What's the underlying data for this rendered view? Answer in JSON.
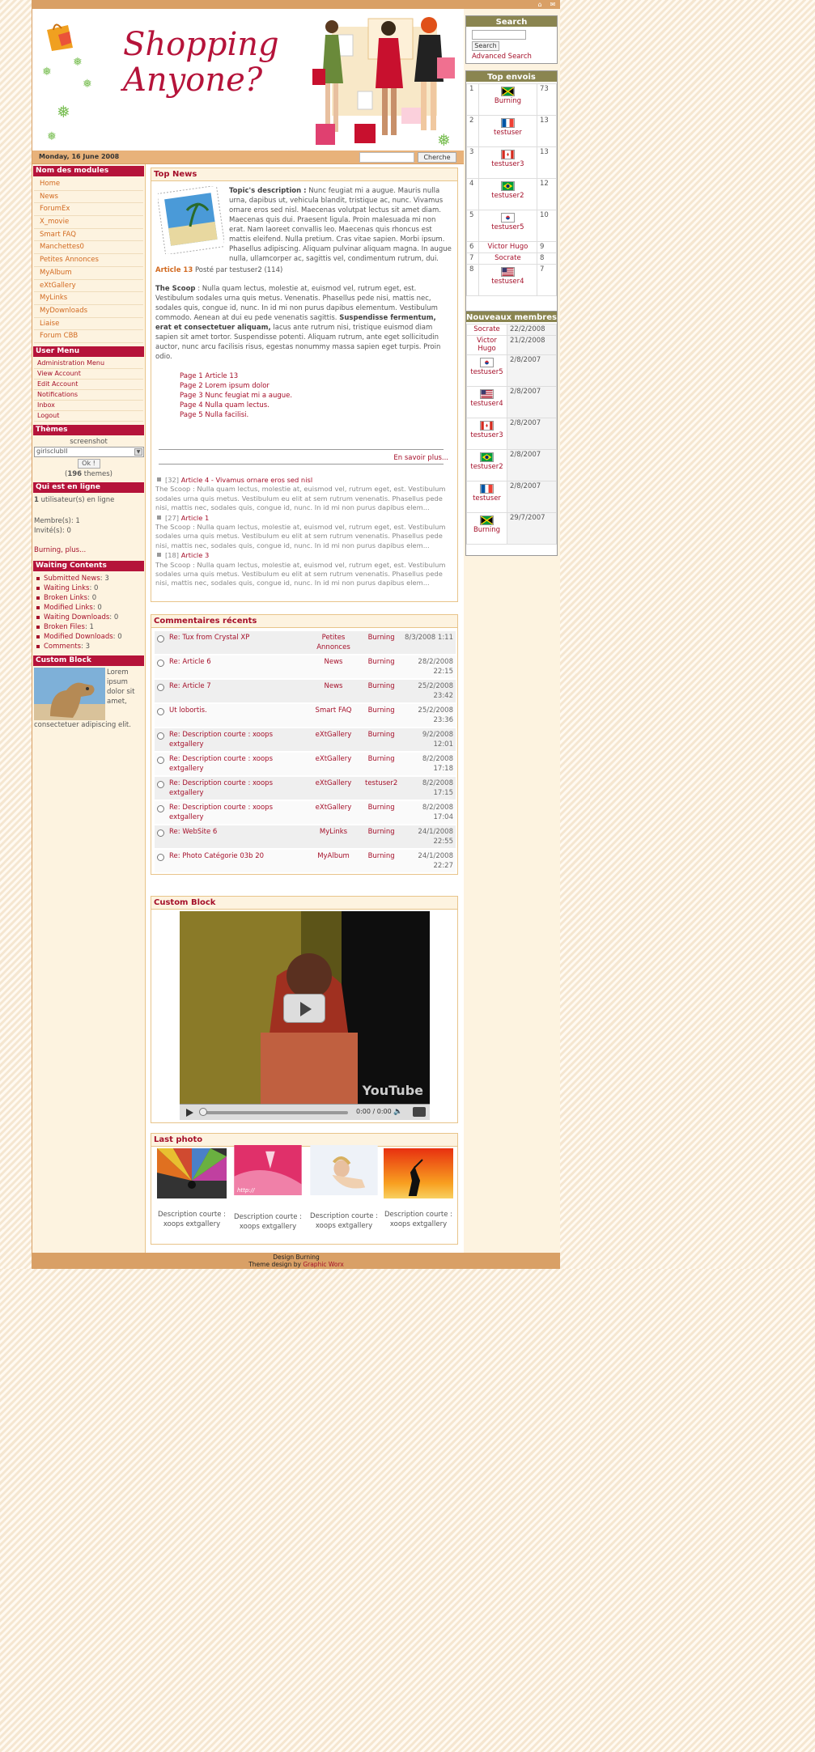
{
  "topbar": {
    "icons": [
      "home-icon",
      "mail-icon"
    ]
  },
  "header": {
    "logo_line1": "Shopping",
    "logo_line2": "Anyone?"
  },
  "datebar": {
    "date": "Monday, 16 June 2008",
    "search_button": "Cherche",
    "search_value": ""
  },
  "left": {
    "modules_title": "Nom des modules",
    "modules": [
      "Home",
      "News",
      "ForumEx",
      "X_movie",
      "Smart FAQ",
      "Manchettes0",
      "Petites Annonces",
      "MyAlbum",
      "eXtGallery",
      "MyLinks",
      "MyDownloads",
      "Liaise",
      "Forum CBB"
    ],
    "user_menu_title": "User Menu",
    "user_menu": [
      "Administration Menu",
      "View Account",
      "Edit Account",
      "Notifications",
      "Inbox",
      "Logout"
    ],
    "themes_title": "Thèmes",
    "themes_label": "screenshot",
    "themes_select": "girlsclubII",
    "themes_ok": "Ok !",
    "themes_count": "196",
    "themes_suffix": "themes)",
    "themes_prefix": "(",
    "online_title": "Qui est en ligne",
    "online_count": "1",
    "online_text": "utilisateur(s) en ligne",
    "members_line": "Membre(s): 1",
    "guests_line": "Invité(s): 0",
    "online_users": "Burning, plus...",
    "waiting_title": "Waiting Contents",
    "waiting": [
      {
        "label": "Submitted News",
        "count": "3"
      },
      {
        "label": "Waiting Links",
        "count": "0"
      },
      {
        "label": "Broken Links",
        "count": "0"
      },
      {
        "label": "Modified Links",
        "count": "0"
      },
      {
        "label": "Waiting Downloads",
        "count": "0"
      },
      {
        "label": "Broken Files",
        "count": "1"
      },
      {
        "label": "Modified Downloads",
        "count": "0"
      },
      {
        "label": "Comments",
        "count": "3"
      }
    ],
    "custom_title": "Custom Block",
    "custom_text": "Lorem ipsum dolor sit amet, consectetuer adipiscing elit."
  },
  "right": {
    "search_title": "Search",
    "search_button": "Search",
    "advanced_search": "Advanced Search",
    "top_title": "Top envois",
    "top": [
      {
        "rank": "1",
        "name": "Burning",
        "count": "73",
        "flag": "jamaica"
      },
      {
        "rank": "2",
        "name": "testuser",
        "count": "13",
        "flag": "france"
      },
      {
        "rank": "3",
        "name": "testuser3",
        "count": "13",
        "flag": "canada"
      },
      {
        "rank": "4",
        "name": "testuser2",
        "count": "12",
        "flag": "brazil"
      },
      {
        "rank": "5",
        "name": "testuser5",
        "count": "10",
        "flag": "korea"
      },
      {
        "rank": "6",
        "name": "Victor Hugo",
        "count": "9",
        "flag": ""
      },
      {
        "rank": "7",
        "name": "Socrate",
        "count": "8",
        "flag": ""
      },
      {
        "rank": "8",
        "name": "testuser4",
        "count": "7",
        "flag": "usa"
      }
    ],
    "new_title": "Nouveaux membres",
    "new_members": [
      {
        "name": "Socrate",
        "date": "22/2/2008",
        "flag": ""
      },
      {
        "name": "Victor Hugo",
        "date": "21/2/2008",
        "flag": ""
      },
      {
        "name": "testuser5",
        "date": "2/8/2007",
        "flag": "korea"
      },
      {
        "name": "testuser4",
        "date": "2/8/2007",
        "flag": "usa"
      },
      {
        "name": "testuser3",
        "date": "2/8/2007",
        "flag": "canada"
      },
      {
        "name": "testuser2",
        "date": "2/8/2007",
        "flag": "brazil"
      },
      {
        "name": "testuser",
        "date": "2/8/2007",
        "flag": "france"
      },
      {
        "name": "Burning",
        "date": "29/7/2007",
        "flag": "jamaica"
      }
    ]
  },
  "news": {
    "title": "Top News",
    "topic_label": "Topic's description :",
    "topic_text": "Nunc feugiat mi a augue. Mauris nulla urna, dapibus ut, vehicula blandit, tristique ac, nunc. Vivamus ornare eros sed nisl. Maecenas volutpat lectus sit amet diam. Maecenas quis dui. Praesent ligula. Proin malesuada mi non erat. Nam laoreet convallis leo. Maecenas quis rhoncus est mattis eleifend. Nulla pretium. Cras vitae sapien. Morbi ipsum. Phasellus adipiscing. Aliquam pulvinar aliquam magna. In augue nulla, ullamcorper ac, sagittis vel, condimentum rutrum, dui.",
    "article_title": "Article 13",
    "posted_by": "Posté par testuser2 (114)",
    "scoop_label": "The Scoop",
    "scoop_text1": ": Nulla quam lectus, molestie at, euismod vel, rutrum eget, est. Vestibulum sodales urna quis metus. Venenatis. Phasellus pede nisi, mattis nec, sodales quis, congue id, nunc. In id mi non purus dapibus elementum. Vestibulum commodo. Aenean at dui eu pede venenatis sagittis.",
    "scoop_bold": "Suspendisse fermentum, erat et consectetuer aliquam,",
    "scoop_text2": "lacus ante rutrum nisi, tristique euismod diam sapien sit amet tortor. Suspendisse potenti. Aliquam rutrum, ante eget sollicitudin auctor, nunc arcu facilisis risus, egestas nonummy massa sapien eget turpis. Proin odio.",
    "pages": [
      "Page 1 Article 13",
      "Page 2 Lorem ipsum dolor",
      "Page 3 Nunc feugiat mi a augue.",
      "Page 4 Nulla quam lectus.",
      "Page 5 Nulla facilisi."
    ],
    "read_more": "En savoir plus...",
    "others": [
      {
        "num": "[32]",
        "title": "Article 4 - Vivamus ornare eros sed nisl",
        "text": "The Scoop : Nulla quam lectus, molestie at, euismod vel, rutrum eget, est. Vestibulum sodales urna quis metus. Vestibulum eu elit at sem rutrum venenatis. Phasellus pede nisi, mattis nec, sodales quis, congue id, nunc. In id mi non purus dapibus elem..."
      },
      {
        "num": "[27]",
        "title": "Article 1",
        "text": "The Scoop : Nulla quam lectus, molestie at, euismod vel, rutrum eget, est. Vestibulum sodales urna quis metus. Vestibulum eu elit at sem rutrum venenatis. Phasellus pede nisi, mattis nec, sodales quis, congue id, nunc. In id mi non purus dapibus elem..."
      },
      {
        "num": "[18]",
        "title": "Article 3",
        "text": "The Scoop : Nulla quam lectus, molestie at, euismod vel, rutrum eget, est. Vestibulum sodales urna quis metus. Vestibulum eu elit at sem rutrum venenatis. Phasellus pede nisi, mattis nec, sodales quis, congue id, nunc. In id mi non purus dapibus elem..."
      }
    ]
  },
  "comments": {
    "title": "Commentaires récents",
    "rows": [
      {
        "title": "Re: Tux from Crystal XP",
        "module": "Petites Annonces",
        "user": "Burning",
        "date": "8/3/2008 1:11"
      },
      {
        "title": "Re: Article 6",
        "module": "News",
        "user": "Burning",
        "date": "28/2/2008 22:15"
      },
      {
        "title": "Re: Article 7",
        "module": "News",
        "user": "Burning",
        "date": "25/2/2008 23:42"
      },
      {
        "title": "Ut lobortis.",
        "module": "Smart FAQ",
        "user": "Burning",
        "date": "25/2/2008 23:36"
      },
      {
        "title": "Re: Description courte : xoops extgallery",
        "module": "eXtGallery",
        "user": "Burning",
        "date": "9/2/2008 12:01"
      },
      {
        "title": "Re: Description courte : xoops extgallery",
        "module": "eXtGallery",
        "user": "Burning",
        "date": "8/2/2008 17:18"
      },
      {
        "title": "Re: Description courte : xoops extgallery",
        "module": "eXtGallery",
        "user": "testuser2",
        "date": "8/2/2008 17:15"
      },
      {
        "title": "Re: Description courte : xoops extgallery",
        "module": "eXtGallery",
        "user": "Burning",
        "date": "8/2/2008 17:04"
      },
      {
        "title": "Re: WebSite 6",
        "module": "MyLinks",
        "user": "Burning",
        "date": "24/1/2008 22:55"
      },
      {
        "title": "Re: Photo Catégorie 03b 20",
        "module": "MyAlbum",
        "user": "Burning",
        "date": "24/1/2008 22:27"
      }
    ]
  },
  "video": {
    "title": "Custom Block",
    "time": "0:00 / 0:00",
    "brand": "YouTube"
  },
  "photos": {
    "title": "Last photo",
    "items": [
      {
        "caption": "Description courte : xoops extgallery"
      },
      {
        "caption": "Description courte : xoops extgallery",
        "overlay": "http://"
      },
      {
        "caption": "Description courte : xoops extgallery"
      },
      {
        "caption": "Description courte : xoops extgallery"
      }
    ]
  },
  "footer": {
    "line1": "Design Burning",
    "line2_prefix": "Theme design by",
    "line2_link": "Graphic Worx"
  },
  "colors": {
    "brand": "#b5133a",
    "accent": "#d9a066",
    "olive": "#8a8550",
    "link": "#a5102a"
  }
}
